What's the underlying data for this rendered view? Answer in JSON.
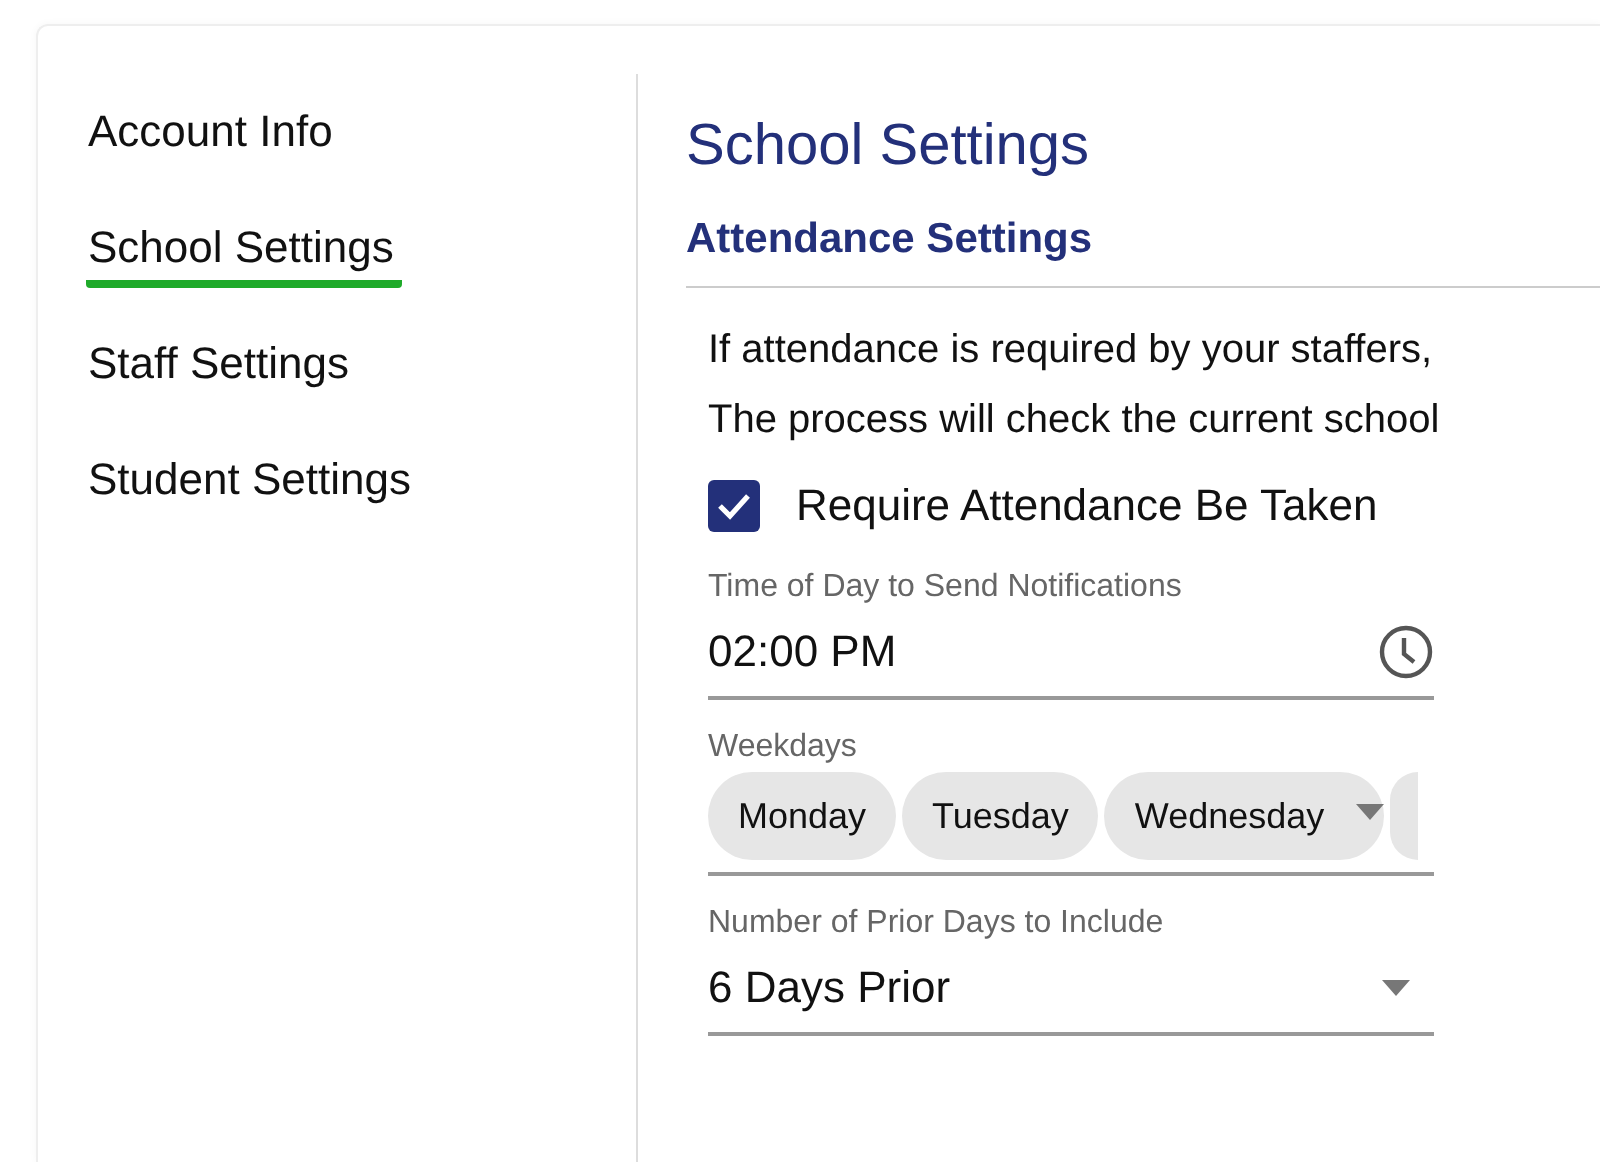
{
  "sidebar": {
    "items": [
      {
        "label": "Account Info",
        "selected": false
      },
      {
        "label": "School Settings",
        "selected": true
      },
      {
        "label": "Staff Settings",
        "selected": false
      },
      {
        "label": "Student Settings",
        "selected": false
      }
    ]
  },
  "page_title": "School Settings",
  "section": {
    "title": "Attendance Settings",
    "description": [
      "If attendance is required by your staffers,",
      "The process will check the current school"
    ],
    "require_attendance": {
      "label": "Require Attendance Be Taken",
      "checked": true
    },
    "time_field": {
      "label": "Time of Day to Send Notifications",
      "value": "02:00 PM"
    },
    "weekdays_field": {
      "label": "Weekdays",
      "chips": [
        "Monday",
        "Tuesday",
        "Wednesday"
      ]
    },
    "prior_days_field": {
      "label": "Number of Prior Days to Include",
      "value": "6 Days Prior"
    }
  }
}
